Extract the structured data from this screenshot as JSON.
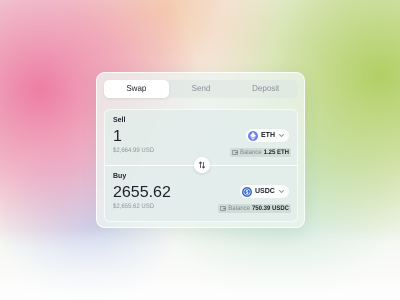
{
  "tabs": [
    {
      "label": "Swap",
      "active": true
    },
    {
      "label": "Send",
      "active": false
    },
    {
      "label": "Deposit",
      "active": false
    }
  ],
  "sell": {
    "label": "Sell",
    "amount": "1",
    "usd_value": "$2,664.99 USD",
    "token": "ETH",
    "token_icon": "ethereum-icon",
    "balance_label": "Balance",
    "balance_value": "1.25 ETH"
  },
  "buy": {
    "label": "Buy",
    "amount": "2655.62",
    "usd_value": "$2,655.62 USD",
    "token": "USDC",
    "token_icon": "usdc-icon",
    "balance_label": "Balance",
    "balance_value": "750.39 USDC"
  },
  "colors": {
    "eth_icon": "#6b7fe6",
    "usdc_icon": "#2f63c9",
    "text_primary": "#1d2128",
    "text_muted": "#8d939a"
  }
}
